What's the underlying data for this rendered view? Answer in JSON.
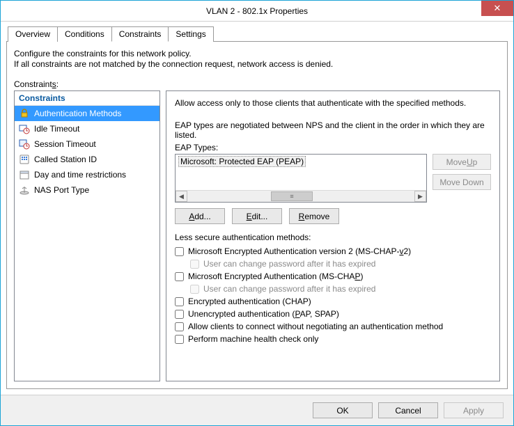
{
  "window": {
    "title": "VLAN 2 - 802.1x Properties",
    "close_glyph": "✕"
  },
  "tabs": {
    "overview": "Overview",
    "conditions": "Conditions",
    "constraints": "Constraints",
    "settings": "Settings"
  },
  "panel": {
    "desc1": "Configure the constraints for this network policy.",
    "desc2": "If all constraints are not matched by the connection request, network access is denied.",
    "constraints_prefix": "Constraint",
    "constraints_accel": "s",
    "constraints_suffix": ":"
  },
  "left": {
    "header": "Constraints",
    "items": [
      {
        "label": "Authentication Methods"
      },
      {
        "label": "Idle Timeout"
      },
      {
        "label": "Session Timeout"
      },
      {
        "label": "Called Station ID"
      },
      {
        "label": "Day and time restrictions"
      },
      {
        "label": "NAS Port Type"
      }
    ]
  },
  "right": {
    "intro": "Allow access only to those clients that authenticate with the specified methods.",
    "eap_desc": "EAP types are negotiated between NPS and the client in the order in which they are listed.",
    "eap_label": "EAP Types:",
    "eap_items": [
      "Microsoft: Protected EAP (PEAP)"
    ],
    "move_up_pre": "Move ",
    "move_up_accel": "U",
    "move_up_post": "p",
    "move_down_label": "Move Down",
    "add_accel": "A",
    "add_post": "dd...",
    "edit_accel": "E",
    "edit_post": "dit...",
    "remove_accel": "R",
    "remove_post": "emove",
    "less_secure_label": "Less secure authentication methods:",
    "chk_mschapv2_pre": "Microsoft Encrypted Authentication version 2 (MS-CHAP-",
    "chk_mschapv2_accel": "v",
    "chk_mschapv2_post": "2)",
    "chk_pwexp": "User can change password after it has expired",
    "chk_mschap_pre": "Microsoft Encrypted Authentication (MS-CHA",
    "chk_mschap_accel": "P",
    "chk_mschap_post": ")",
    "chk_chap": "Encrypted authentication (CHAP)",
    "chk_pap_pre": "Unencrypted authentication (",
    "chk_pap_accel": "P",
    "chk_pap_post": "AP, SPAP)",
    "chk_nonego": "Allow clients to connect without negotiating an authentication method",
    "chk_health": "Perform machine health check only"
  },
  "footer": {
    "ok": "OK",
    "cancel": "Cancel",
    "apply": "Apply"
  }
}
